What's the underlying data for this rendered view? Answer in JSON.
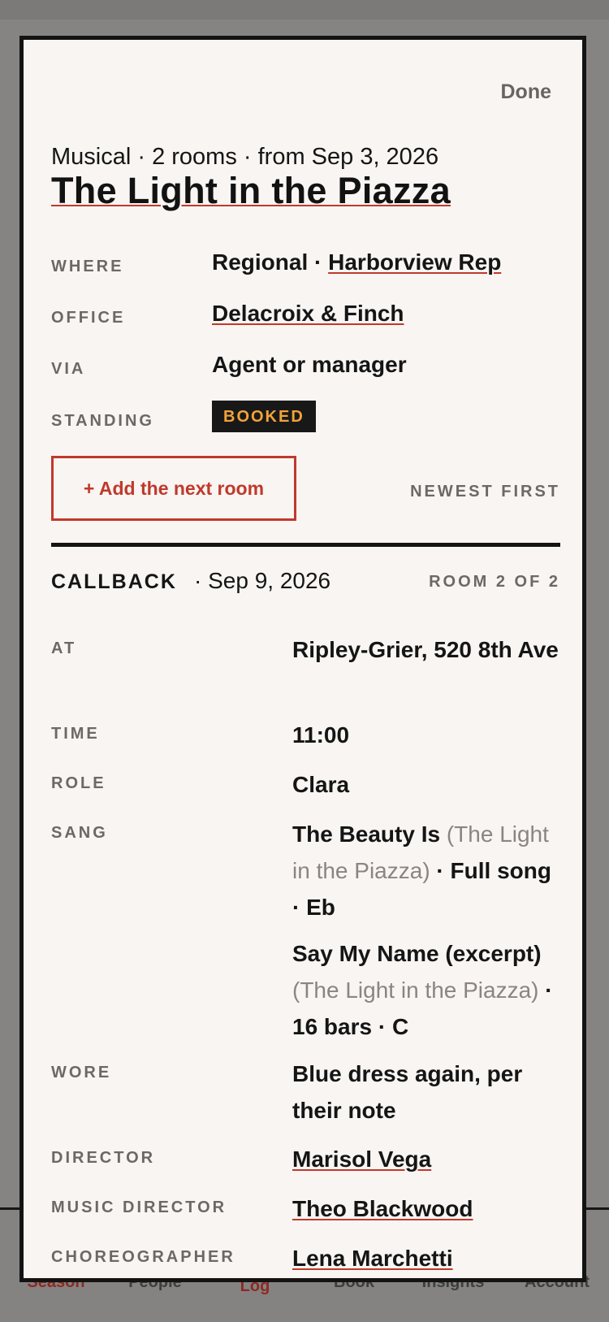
{
  "sheet": {
    "done_label": "Done",
    "meta": "Musical · 2 rooms · from Sep 3, 2026",
    "title": "The Light in the Piazza",
    "details": {
      "where_label": "WHERE",
      "where_region": "Regional · ",
      "where_theater": "Harborview Rep",
      "office_label": "OFFICE",
      "office_value": "Delacroix & Finch",
      "via_label": "VIA",
      "via_value": "Agent or manager",
      "standing_label": "STANDING",
      "standing_value": "BOOKED"
    },
    "add_room_label": "+ Add the next room",
    "sort_label": "NEWEST FIRST",
    "accent_color": "#c0392b",
    "badge_text_color": "#f2a33a"
  },
  "room": {
    "type": "CALLBACK",
    "date": " · Sep 9, 2026",
    "count": "ROOM 2 OF 2",
    "at_label": "AT",
    "at_value": "Ripley-Grier, 520 8th Ave",
    "time_label": "TIME",
    "time_value": "11:00",
    "role_label": "ROLE",
    "role_value": "Clara",
    "sang_label": "SANG",
    "songs": [
      {
        "title": "The Beauty Is",
        "show": "(The Light in the Piazza)",
        "detail": "· Full song · Eb"
      },
      {
        "title": "Say My Name (excerpt)",
        "show": "(The Light in the Piazza)",
        "detail": "· 16 bars · C"
      }
    ],
    "wore_label": "WORE",
    "wore_value": "Blue dress again, per their note",
    "director_label": "DIRECTOR",
    "director_value": "Marisol Vega",
    "music_director_label": "MUSIC DIRECTOR",
    "music_director_value": "Theo Blackwood",
    "choreographer_label": "CHOREOGRAPHER",
    "choreographer_value": "Lena Marchetti"
  },
  "tabbar": {
    "tabs": [
      {
        "label": "Season",
        "active": true
      },
      {
        "label": "People",
        "active": false
      },
      {
        "label": "Log",
        "active": false
      },
      {
        "label": "Book",
        "active": false
      },
      {
        "label": "Insights",
        "active": false
      },
      {
        "label": "Account",
        "active": false
      }
    ]
  }
}
